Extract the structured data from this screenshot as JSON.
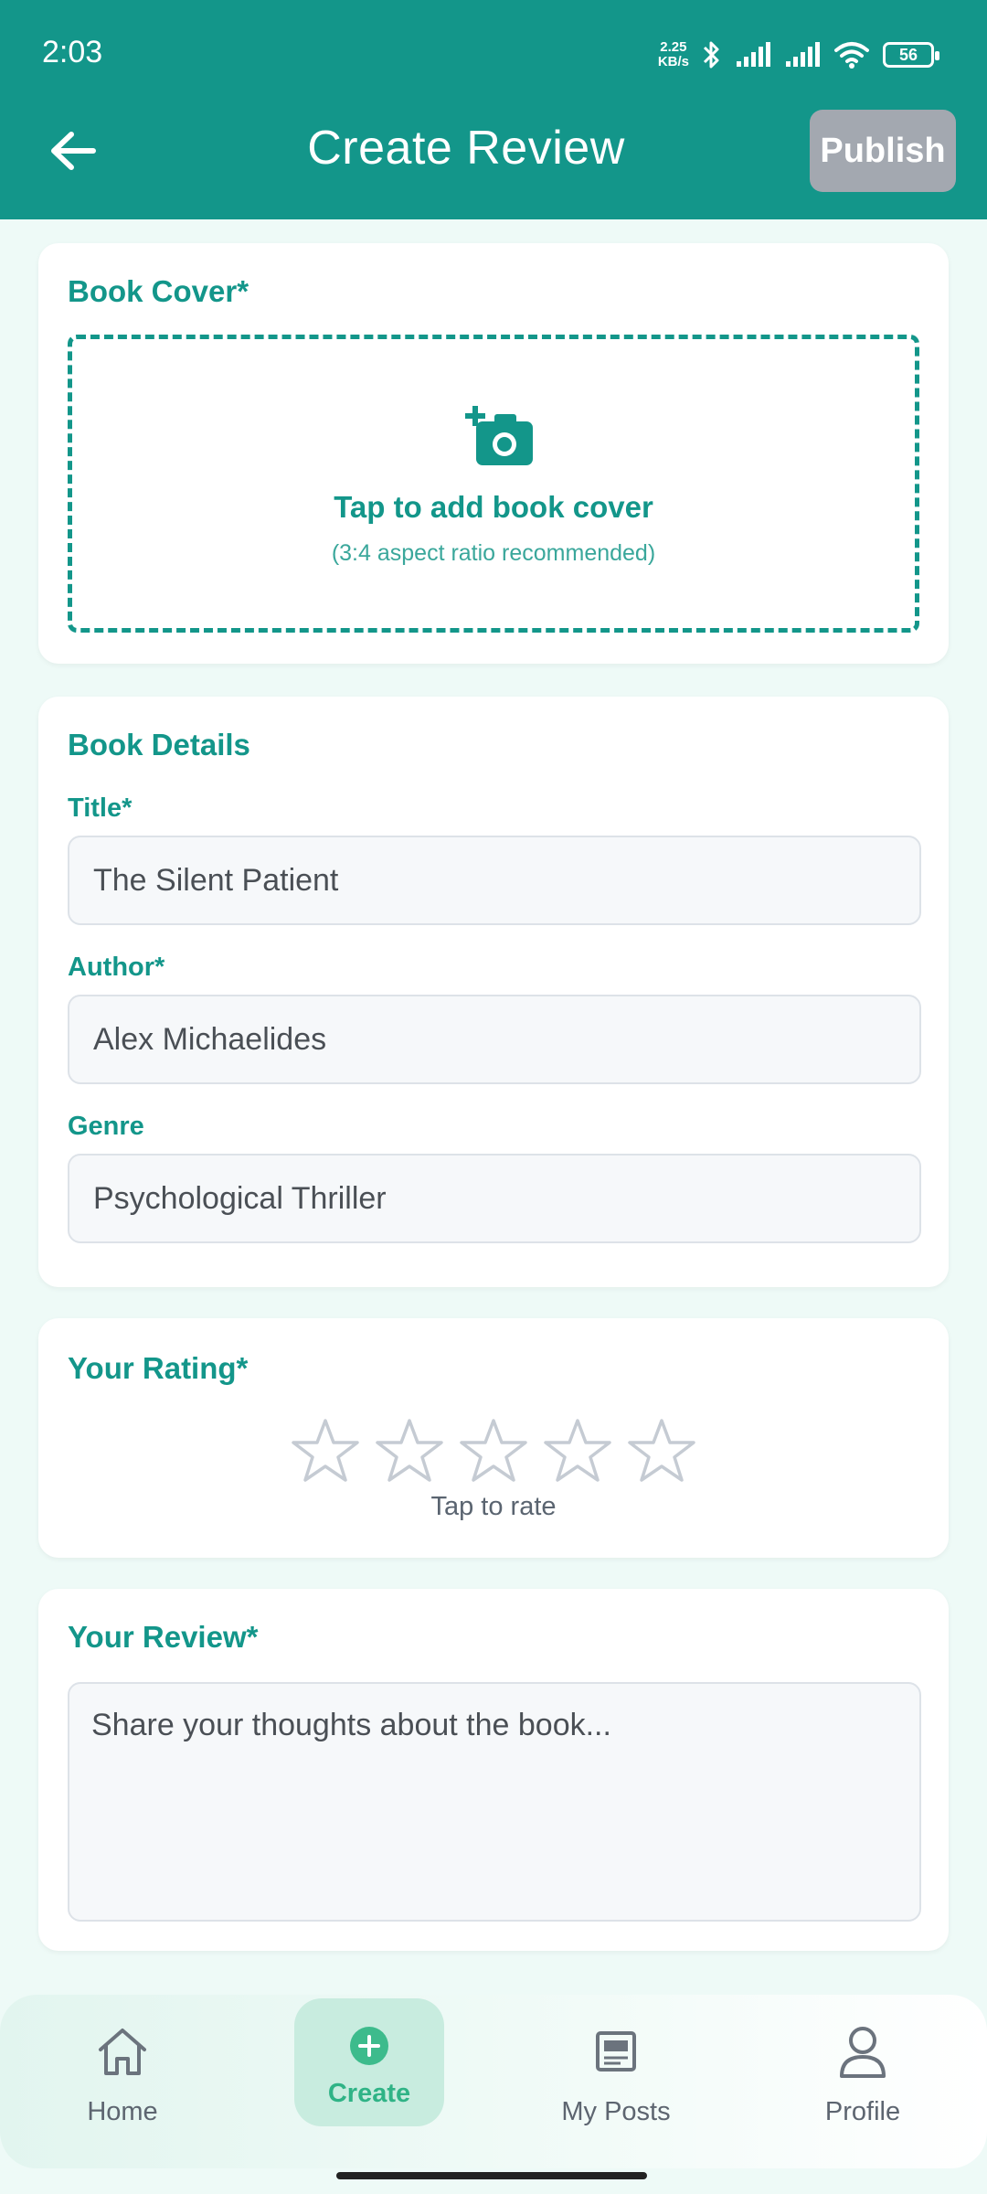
{
  "status_bar": {
    "time": "2:03",
    "net_speed_value": "2.25",
    "net_speed_unit": "KB/s",
    "battery": "56"
  },
  "header": {
    "title": "Create Review",
    "publish_label": "Publish"
  },
  "cover": {
    "section_title": "Book Cover*",
    "upload_text": "Tap to add book cover",
    "upload_hint": "(3:4 aspect ratio recommended)"
  },
  "details": {
    "section_title": "Book Details",
    "title_label": "Title*",
    "title_value": "The Silent Patient",
    "author_label": "Author*",
    "author_value": "Alex Michaelides",
    "genre_label": "Genre",
    "genre_value": "Psychological Thriller"
  },
  "rating": {
    "section_title": "Your Rating*",
    "value": 0,
    "max": 5,
    "hint": "Tap to rate"
  },
  "review": {
    "section_title": "Your Review*",
    "placeholder": "Share your thoughts about the book..."
  },
  "nav": {
    "items": [
      {
        "label": "Home"
      },
      {
        "label": "Create"
      },
      {
        "label": "My Posts"
      },
      {
        "label": "Profile"
      }
    ],
    "active": "Create"
  },
  "colors": {
    "primary": "#13968a",
    "accent_green": "#2fb386",
    "publish_disabled": "#a3a8b0"
  }
}
